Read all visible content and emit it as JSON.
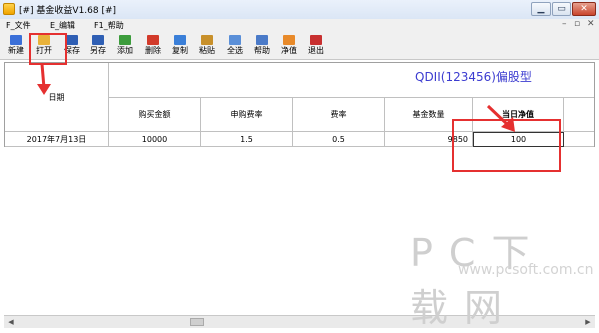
{
  "window": {
    "title": "[#] 基金收益V1.68 [#]",
    "min_label": "▁",
    "max_label": "▭",
    "close_label": "✕"
  },
  "menubar": {
    "items": [
      "F_文件",
      "E_编辑",
      "F1_帮助"
    ],
    "right_controls": [
      "–",
      "▫",
      "✕"
    ]
  },
  "toolbar": {
    "buttons": [
      {
        "label": "新建",
        "icon": "new-file-icon",
        "color": "#3a6fd8"
      },
      {
        "label": "打开",
        "icon": "open-folder-icon",
        "color": "#e8b23a"
      },
      {
        "label": "保存",
        "icon": "save-disk-icon",
        "color": "#2f5fb4"
      },
      {
        "label": "另存",
        "icon": "save-as-icon",
        "color": "#2f5fb4"
      },
      {
        "label": "添加",
        "icon": "add-icon",
        "color": "#3c9c3c"
      },
      {
        "label": "删除",
        "icon": "delete-x-icon",
        "color": "#d23a2a"
      },
      {
        "label": "复制",
        "icon": "copy-icon",
        "color": "#3a7fd8"
      },
      {
        "label": "粘贴",
        "icon": "paste-icon",
        "color": "#c8902a"
      },
      {
        "label": "全选",
        "icon": "select-all-icon",
        "color": "#5a8fd8"
      },
      {
        "label": "帮助",
        "icon": "help-book-icon",
        "color": "#4a7ac8"
      },
      {
        "label": "净值",
        "icon": "net-value-flag-icon",
        "color": "#e88a2a"
      },
      {
        "label": "退出",
        "icon": "exit-icon",
        "color": "#c83030"
      }
    ]
  },
  "table": {
    "fund_title": "QDII(123456)偏股型",
    "date_header": "日期",
    "headers": [
      "购买金额",
      "申购费率",
      "费率",
      "基金数量",
      "当日净值"
    ],
    "rows": [
      {
        "date": "2017年7月13日",
        "values": [
          "10000",
          "1.5",
          "0.5",
          "9850",
          "100"
        ]
      }
    ]
  },
  "scrollbar": {
    "left": "◀",
    "right": "▶"
  },
  "watermark": {
    "text": "PC下载网",
    "url": "www.pcsoft.com.cn"
  },
  "colors": {
    "highlight": "#e53030",
    "fund_title": "#3c3cd0"
  }
}
